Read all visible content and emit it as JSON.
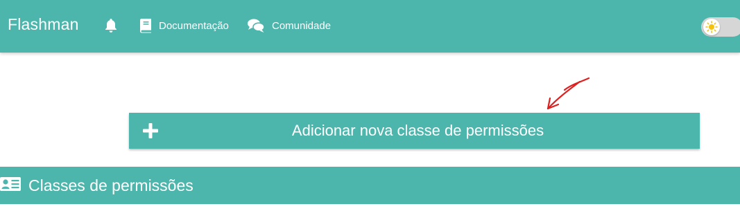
{
  "navbar": {
    "brand": "Flashman",
    "items": [
      {
        "icon": "bell-icon",
        "label": ""
      },
      {
        "icon": "book-icon",
        "label": "Documentação"
      },
      {
        "icon": "comments-icon",
        "label": "Comunidade"
      }
    ],
    "theme_toggle": {
      "icon": "sun-icon",
      "state": "light"
    }
  },
  "main": {
    "add_button": {
      "icon": "plus-icon",
      "label": "Adicionar nova classe de permissões"
    },
    "section_header": {
      "icon": "id-card-icon",
      "title": "Classes de permissões"
    }
  },
  "colors": {
    "primary": "#4db6ac",
    "on_primary": "#ffffff",
    "toggle_track": "#d6d6d6",
    "sun": "#f4c20d",
    "annotation_arrow": "#e02020"
  }
}
